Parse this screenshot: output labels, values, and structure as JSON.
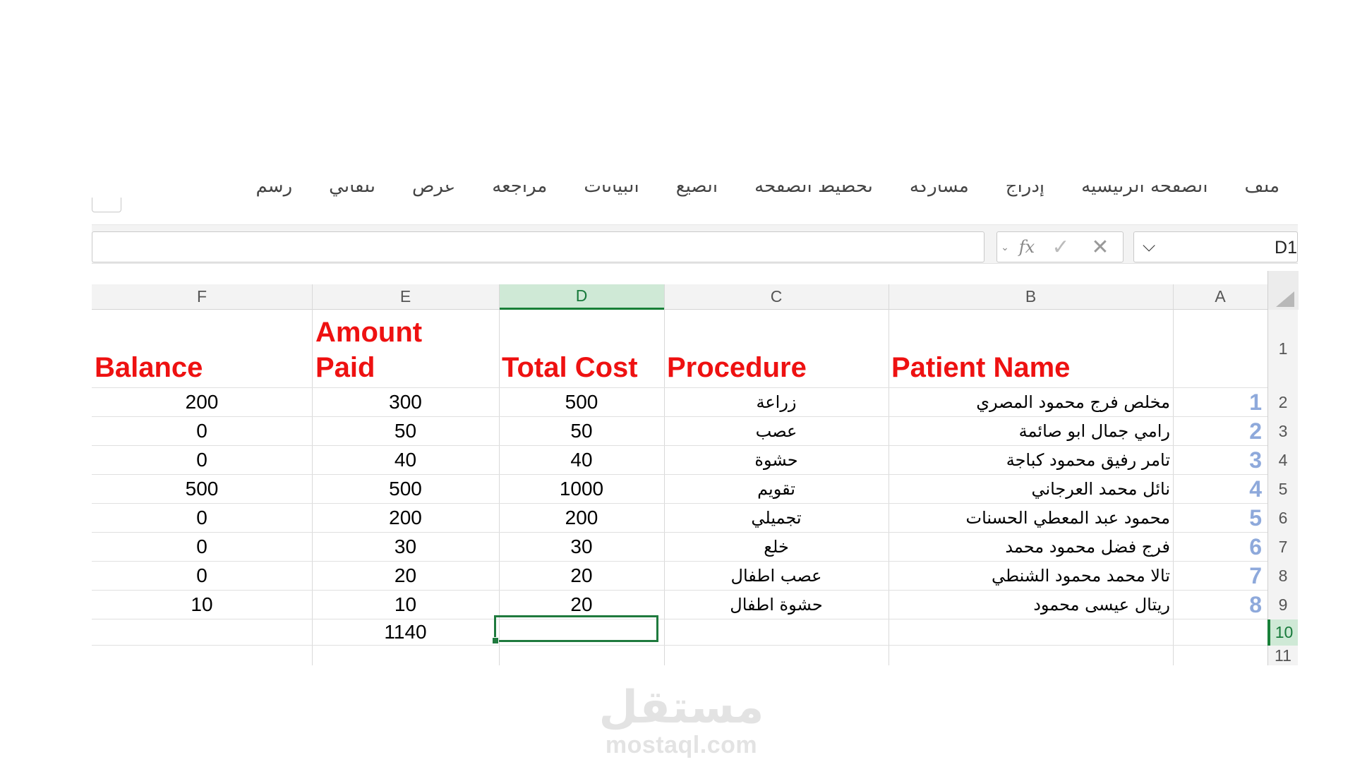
{
  "ribbon": {
    "tabs": [
      "ملف",
      "الصفحة الرئيسية",
      "إدراج",
      "مشاركة",
      "تخطيط الصفحة",
      "الصيغ",
      "البيانات",
      "مراجعة",
      "عرض",
      "تلقائي",
      "رسم"
    ]
  },
  "formula_bar": {
    "name_box": "D1",
    "formula": "",
    "fx_label": "fx",
    "check_label": "✓",
    "cancel_label": "✕"
  },
  "columns": [
    "A",
    "B",
    "C",
    "D",
    "E",
    "F"
  ],
  "selected_column": "D",
  "row_numbers": [
    "1",
    "2",
    "3",
    "4",
    "5",
    "6",
    "7",
    "8",
    "9",
    "10",
    "11"
  ],
  "selected_row": "10",
  "table": {
    "headers": {
      "patient_name": "Patient Name",
      "procedure": "Procedure",
      "total_cost": "Total Cost",
      "amount_paid_1": "Amount",
      "amount_paid_2": "Paid",
      "balance": "Balance"
    },
    "rows": [
      {
        "no": "1",
        "name": "مخلص فرج محمود المصري",
        "procedure": "زراعة",
        "total": "500",
        "paid": "300",
        "balance": "200"
      },
      {
        "no": "2",
        "name": "رامي جمال ابو صائمة",
        "procedure": "عصب",
        "total": "50",
        "paid": "50",
        "balance": "0"
      },
      {
        "no": "3",
        "name": "تامر رفيق محمود كباجة",
        "procedure": "حشوة",
        "total": "40",
        "paid": "40",
        "balance": "0"
      },
      {
        "no": "4",
        "name": "نائل محمد العرجاني",
        "procedure": "تقويم",
        "total": "1000",
        "paid": "500",
        "balance": "500"
      },
      {
        "no": "5",
        "name": "محمود عبد المعطي الحسنات",
        "procedure": "تجميلي",
        "total": "200",
        "paid": "200",
        "balance": "0"
      },
      {
        "no": "6",
        "name": "فرج فضل محمود محمد",
        "procedure": "خلع",
        "total": "30",
        "paid": "30",
        "balance": "0"
      },
      {
        "no": "7",
        "name": "تالا محمد محمود الشنطي",
        "procedure": "عصب اطفال",
        "total": "20",
        "paid": "20",
        "balance": "0"
      },
      {
        "no": "8",
        "name": "ريتال عيسى محمود",
        "procedure": "حشوة اطفال",
        "total": "20",
        "paid": "10",
        "balance": "10"
      }
    ],
    "total_paid": "1140"
  },
  "watermark": {
    "logo": "مستقل",
    "url": "mostaql.com"
  },
  "colors": {
    "header_red": "#ee1111",
    "index_blue": "#8ea9db",
    "selection_green": "#188038"
  }
}
